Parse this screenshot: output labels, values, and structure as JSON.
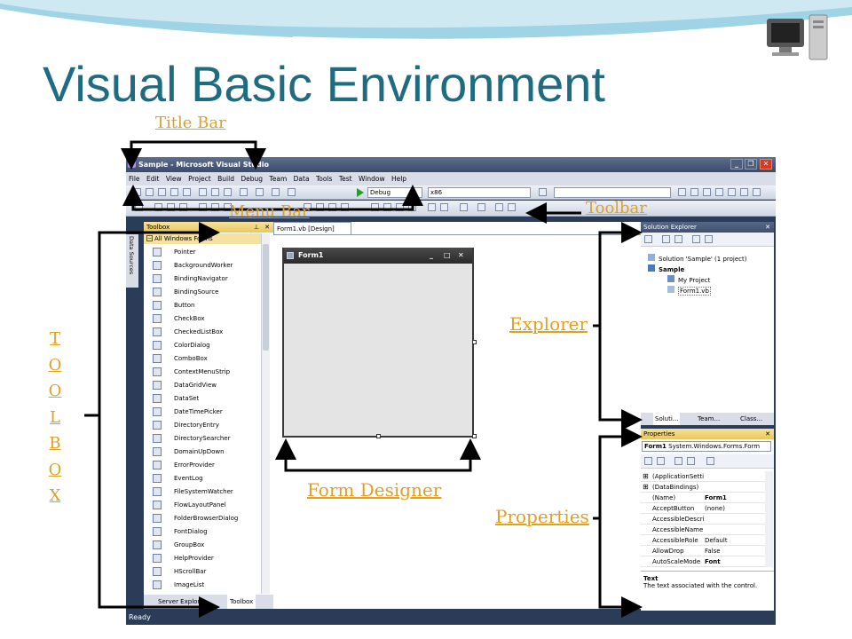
{
  "slide": {
    "title": "Visual Basic Environment",
    "callouts": {
      "title_bar": "Title Bar",
      "menu_bar": "Menu Bar",
      "toolbar": "Toolbar",
      "explorer": "Explorer",
      "form_designer": "Form Designer",
      "properties": "Properties",
      "toolbox_letters": [
        "T",
        "O",
        "O",
        "L",
        "B",
        "O",
        "X"
      ]
    },
    "colors": {
      "title": "#1f6b82",
      "callout": "#e0a020",
      "ide_frame": "#2b3c59"
    }
  },
  "vs": {
    "title": "Sample - Microsoft Visual Studio",
    "window_buttons": [
      "_",
      "❐",
      "✕"
    ],
    "menu": [
      "File",
      "Edit",
      "View",
      "Project",
      "Build",
      "Debug",
      "Team",
      "Data",
      "Tools",
      "Test",
      "Window",
      "Help"
    ],
    "config_combo": "Debug",
    "platform_combo": "x86",
    "toolbox": {
      "header": "Toolbox",
      "side_tab": "Data Sources",
      "group": "All Windows Forms",
      "items": [
        "Pointer",
        "BackgroundWorker",
        "BindingNavigator",
        "BindingSource",
        "Button",
        "CheckBox",
        "CheckedListBox",
        "ColorDialog",
        "ComboBox",
        "ContextMenuStrip",
        "DataGridView",
        "DataSet",
        "DateTimePicker",
        "DirectoryEntry",
        "DirectorySearcher",
        "DomainUpDown",
        "ErrorProvider",
        "EventLog",
        "FileSystemWatcher",
        "FlowLayoutPanel",
        "FolderBrowserDialog",
        "FontDialog",
        "GroupBox",
        "HelpProvider",
        "HScrollBar",
        "ImageList"
      ],
      "bottom_tabs": [
        "Server Explorer",
        "Toolbox"
      ]
    },
    "designer": {
      "tab": "Form1.vb [Design]",
      "form_title": "Form1"
    },
    "solution_explorer": {
      "header": "Solution Explorer",
      "tree": [
        "Solution 'Sample' (1 project)",
        "Sample",
        "My Project",
        "Form1.vb"
      ],
      "tabs": [
        "Soluti...",
        "Team...",
        "Class..."
      ]
    },
    "properties": {
      "header": "Properties",
      "object": "Form1",
      "object_type": "System.Windows.Forms.Form",
      "rows": [
        {
          "name": "(ApplicationSetti",
          "value": ""
        },
        {
          "name": "(DataBindings)",
          "value": ""
        },
        {
          "name": "(Name)",
          "value": "Form1"
        },
        {
          "name": "AcceptButton",
          "value": "(none)"
        },
        {
          "name": "AccessibleDescri",
          "value": ""
        },
        {
          "name": "AccessibleName",
          "value": ""
        },
        {
          "name": "AccessibleRole",
          "value": "Default"
        },
        {
          "name": "AllowDrop",
          "value": "False"
        },
        {
          "name": "AutoScaleMode",
          "value": "Font"
        }
      ],
      "desc_title": "Text",
      "desc_text": "The text associated with the control."
    },
    "status": "Ready"
  }
}
